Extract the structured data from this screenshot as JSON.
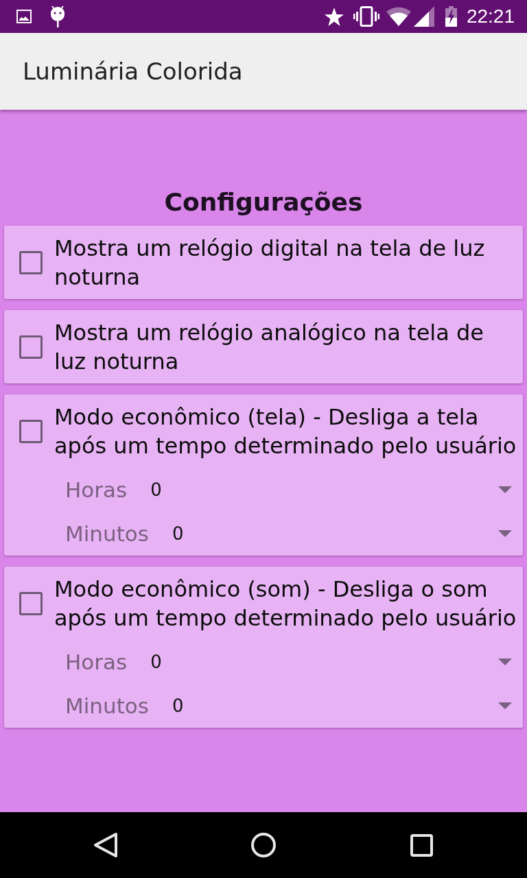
{
  "status_bar": {
    "time": "22:21"
  },
  "app_bar": {
    "title": "Luminária Colorida"
  },
  "heading": "Configurações",
  "settings": [
    {
      "label": "Mostra um relógio digital na tela de luz noturna",
      "checked": false
    },
    {
      "label": "Mostra um relógio analógico na tela de luz noturna",
      "checked": false
    },
    {
      "label": "Modo econômico (tela) - Desliga a tela após um tempo determinado pelo usuário",
      "checked": false,
      "spinners": [
        {
          "label": "Horas",
          "value": "0"
        },
        {
          "label": "Minutos",
          "value": "0"
        }
      ]
    },
    {
      "label": "Modo econômico (som) - Desliga o som após um tempo determinado pelo usuário",
      "checked": false,
      "spinners": [
        {
          "label": "Horas",
          "value": "0"
        },
        {
          "label": "Minutos",
          "value": "0"
        }
      ]
    }
  ]
}
